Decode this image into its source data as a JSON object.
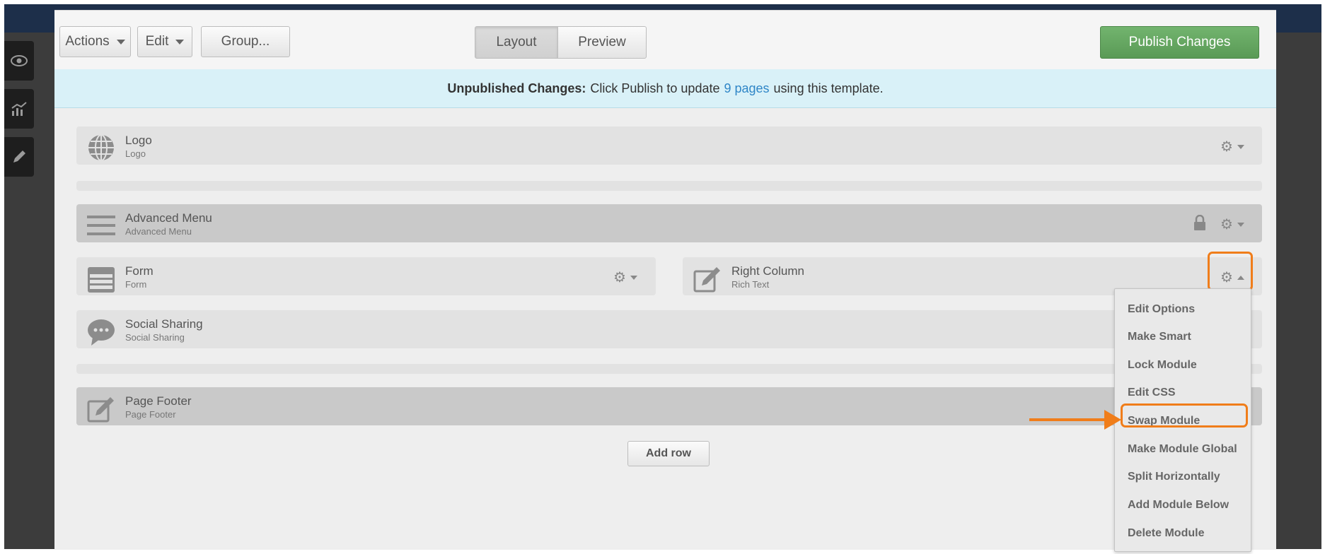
{
  "toolbar": {
    "actions_label": "Actions",
    "edit_label": "Edit",
    "group_label": "Group...",
    "layout_tab": "Layout",
    "preview_tab": "Preview",
    "publish_label": "Publish Changes"
  },
  "notice": {
    "bold": "Unpublished Changes:",
    "pre": "Click Publish to update",
    "link": "9 pages",
    "post": "using this template."
  },
  "modules": {
    "logo": {
      "title": "Logo",
      "subtitle": "Logo"
    },
    "advanced_menu": {
      "title": "Advanced Menu",
      "subtitle": "Advanced Menu"
    },
    "form": {
      "title": "Form",
      "subtitle": "Form"
    },
    "right_column": {
      "title": "Right Column",
      "subtitle": "Rich Text"
    },
    "social_sharing": {
      "title": "Social Sharing",
      "subtitle": "Social Sharing"
    },
    "page_footer": {
      "title": "Page Footer",
      "subtitle": "Page Footer"
    }
  },
  "add_row_label": "Add row",
  "menu": {
    "items": [
      "Edit Options",
      "Make Smart",
      "Lock Module",
      "Edit CSS",
      "Swap Module",
      "Make Module Global",
      "Split Horizontally",
      "Add Module Below",
      "Delete Module"
    ],
    "highlighted": "Swap Module"
  },
  "colors": {
    "accent_orange": "#f07d1a",
    "publish_green": "#5fa05b",
    "notice_bg": "#d9f1f8",
    "link_blue": "#2f86c7"
  }
}
